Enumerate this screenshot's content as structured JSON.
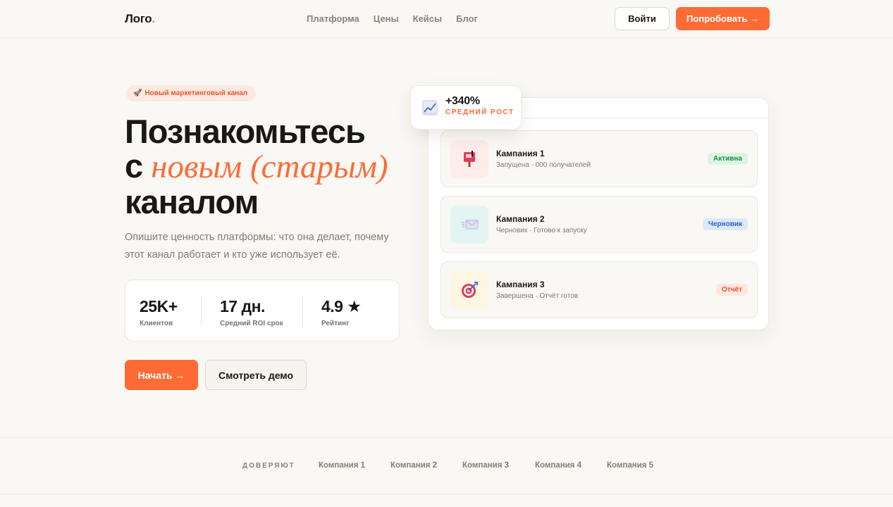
{
  "header": {
    "logo": "Лого",
    "logo_dot": ".",
    "nav": [
      "Платформа",
      "Цены",
      "Кейсы",
      "Блог"
    ],
    "login_label": "Войти",
    "try_label": "Попробовать →"
  },
  "hero": {
    "pill_icon": "🚀",
    "pill_text": "Новый маркетинговый канал",
    "title_line1": "Познакомьтесь",
    "title_line2_prefix": "с ",
    "title_line2_accent": "новым (старым)",
    "title_line3": "каналом",
    "description": "Опишите ценность платформы: что она делает, почему этот канал работает и кто уже использует её.",
    "stats": [
      {
        "value": "25K+",
        "label": "Клиентов"
      },
      {
        "value": "17 дн.",
        "label": "Средний ROI срок"
      },
      {
        "value": "4.9 ★",
        "label": "Рейтинг"
      }
    ],
    "start_label": "Начать →",
    "demo_label": "Смотреть демо"
  },
  "growth": {
    "value": "+340%",
    "label": "СРЕДНИЙ РОСТ",
    "icon": "chart-up-icon"
  },
  "campaigns": [
    {
      "name": "Кампания 1",
      "sub": "Запущена · 000 получателей",
      "badge": "Активна",
      "icon": "mailbox-icon",
      "badge_bg": "#dcf5e3",
      "badge_fg": "#1f8a48",
      "icon_bg": "#fdecea"
    },
    {
      "name": "Кампания 2",
      "sub": "Черновик · Готово к запуску",
      "badge": "Черновик",
      "icon": "envelope-speed-icon",
      "badge_bg": "#dde8fb",
      "badge_fg": "#2d5fc4",
      "icon_bg": "#e3f4f4"
    },
    {
      "name": "Кампания 3",
      "sub": "Завершена · Отчёт готов",
      "badge": "Отчёт",
      "icon": "target-icon",
      "badge_bg": "#fde7df",
      "badge_fg": "#e0552a",
      "icon_bg": "#fdf6e3"
    }
  ],
  "trust": {
    "label": "ДОВЕРЯЮТ",
    "companies": [
      "Компания 1",
      "Компания 2",
      "Компания 3",
      "Компания 4",
      "Компания 5"
    ]
  },
  "colors": {
    "accent": "#ff6b35",
    "background": "#faf8f4"
  }
}
